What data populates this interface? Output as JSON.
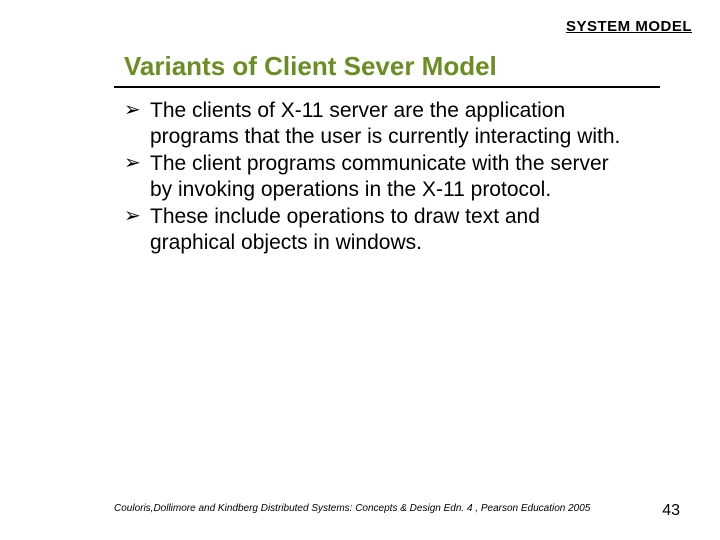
{
  "header": {
    "title": "SYSTEM MODEL"
  },
  "slide": {
    "title": "Variants of Client Sever Model",
    "bullets": [
      "The clients of X-11 server are the application programs that the user is currently interacting with.",
      "The client programs communicate with the server by invoking operations in the X-11 protocol.",
      "These include operations to draw text and graphical objects in windows."
    ]
  },
  "footer": {
    "citation": "Couloris,Dollimore and Kindberg  Distributed Systems: Concepts & Design  Edn. 4 , Pearson Education 2005",
    "page": "43"
  },
  "glyphs": {
    "bullet_arrow": "➢"
  }
}
